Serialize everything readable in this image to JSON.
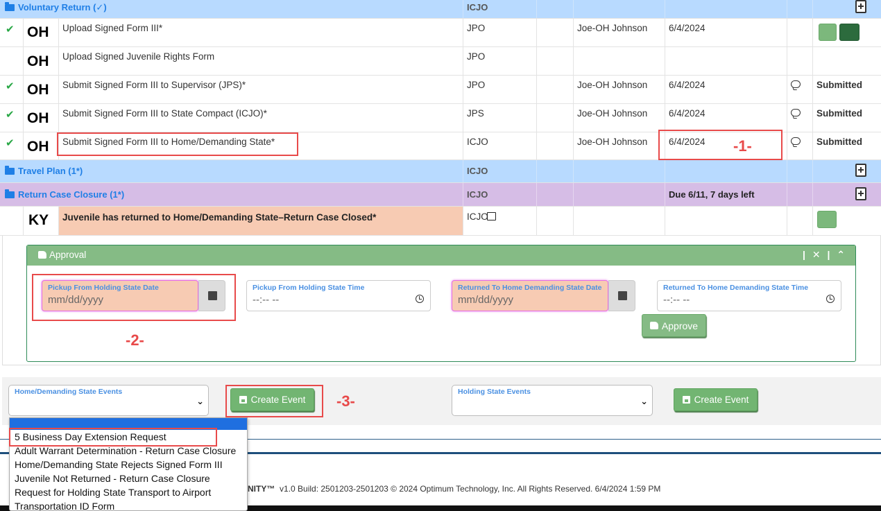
{
  "groups": [
    {
      "title": "Voluntary Return (✓)",
      "code": "ICJO"
    },
    {
      "title": "Travel Plan (1*)",
      "code": "ICJO"
    },
    {
      "title": "Return Case Closure (1*)",
      "code": "ICJO",
      "due": "Due 6/11, 7 days left"
    }
  ],
  "tasks": [
    {
      "check": "✔",
      "state": "OH",
      "name": "Upload Signed Form III*",
      "role": "JPO",
      "user": "Joe-OH Johnson",
      "date": "6/4/2024",
      "status": ""
    },
    {
      "check": "",
      "state": "OH",
      "name": "Upload Signed Juvenile Rights Form",
      "role": "JPO",
      "user": "",
      "date": "",
      "status": ""
    },
    {
      "check": "✔",
      "state": "OH",
      "name": "Submit Signed Form III to Supervisor (JPS)*",
      "role": "JPO",
      "user": "Joe-OH Johnson",
      "date": "6/4/2024",
      "status": "Submitted"
    },
    {
      "check": "✔",
      "state": "OH",
      "name": "Submit Signed Form III to State Compact (ICJO)*",
      "role": "JPS",
      "user": "Joe-OH Johnson",
      "date": "6/4/2024",
      "status": "Submitted"
    },
    {
      "check": "✔",
      "state": "OH",
      "name": "Submit Signed Form III to Home/Demanding State*",
      "role": "ICJO",
      "user": "Joe-OH Johnson",
      "date": "6/4/2024",
      "status": "Submitted"
    }
  ],
  "ky_task": {
    "state": "KY",
    "name": "Juvenile has returned to Home/Demanding State–Return Case Closed*",
    "role": "ICJO"
  },
  "approval": {
    "title": "Approval",
    "controls": "| ✕ | ⌃",
    "fields": [
      {
        "label": "Pickup From Holding State Date",
        "placeholder": "mm/dd/yyyy"
      },
      {
        "label": "Pickup From Holding State Time",
        "placeholder": "--:-- --"
      },
      {
        "label": "Returned To Home Demanding State Date",
        "placeholder": "mm/dd/yyyy"
      },
      {
        "label": "Returned To Home Demanding State Time",
        "placeholder": "--:-- --"
      }
    ],
    "approve_label": "Approve"
  },
  "events": {
    "home_label": "Home/Demanding State Events",
    "holding_label": "Holding State Events",
    "create_label": "Create Event",
    "dropdown_options": [
      "5 Business Day Extension Request",
      "Adult Warrant Determination - Return Case Closure",
      "Home/Demanding State Rejects Signed Form III",
      "Juvenile Not Returned - Return Case Closure",
      "Request for Holding State Transport to Airport",
      "Transportation ID Form"
    ]
  },
  "annotations": {
    "one": "-1-",
    "two": "-2-",
    "three": "-3-"
  },
  "footer": {
    "brand": "NITY™",
    "text": "v1.0 Build: 2501203-2501203 © 2024 Optimum Technology, Inc. All Rights Reserved. 6/4/2024 1:59 PM"
  },
  "colors": {
    "accent": "#1f7fe6",
    "success": "#28a745",
    "annotation": "#e84a4a",
    "highlight": "#f7cbb3"
  }
}
